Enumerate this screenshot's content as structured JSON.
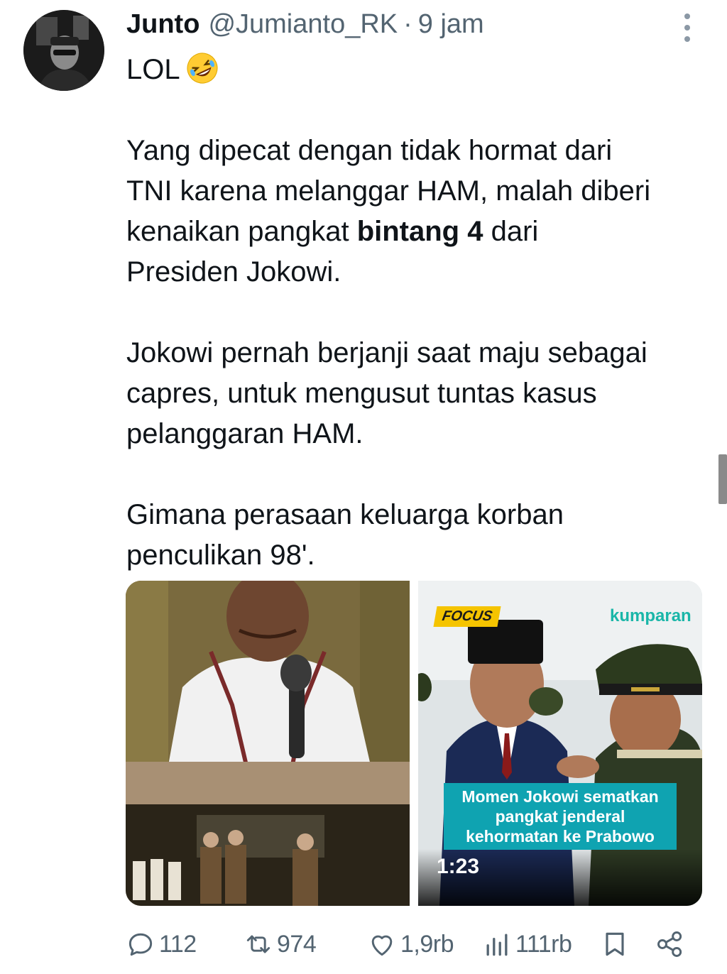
{
  "tweet": {
    "author_name": "Junto",
    "author_handle": "@Jumianto_RK",
    "separator": "·",
    "time": "9 jam",
    "line_lol": "LOL",
    "emoji": "rolling-on-floor-laughing-emoji",
    "p1_line1": "Yang dipecat dengan tidak hormat dari",
    "p1_line2": "TNI karena melanggar HAM, malah diberi",
    "p1_line3_pre": "kenaikan pangkat ",
    "p1_line3_bold": "bintang 4",
    "p1_line3_post": " dari",
    "p1_line4": "Presiden Jokowi.",
    "p2_line1": "Jokowi pernah berjanji saat maju sebagai",
    "p2_line2": "capres, untuk mengusut tuntas kasus",
    "p2_line3": "pelanggaran HAM.",
    "p3_line1": "Gimana perasaan keluarga korban",
    "p3_line2": "penculikan 98'."
  },
  "media": {
    "left_image": "man-speaking-at-microphone-and-military-officers-photo",
    "right_video": {
      "tag": "FOCUS",
      "brand": "kumparan",
      "caption_line1": "Momen Jokowi sematkan",
      "caption_line2": "pangkat jenderal",
      "caption_line3": "kehormatan ke Prabowo",
      "duration": "1:23"
    }
  },
  "actions": {
    "replies": "112",
    "reposts": "974",
    "likes": "1,9rb",
    "views": "111rb",
    "icons": [
      "reply-icon",
      "repost-icon",
      "like-icon",
      "views-icon",
      "bookmark-icon",
      "share-icon"
    ]
  },
  "colors": {
    "text": "#0f1419",
    "muted": "#536471",
    "caption_bg": "#0fa3b1",
    "focus_tag": "#f5c400",
    "brand": "#1ab6a8"
  }
}
